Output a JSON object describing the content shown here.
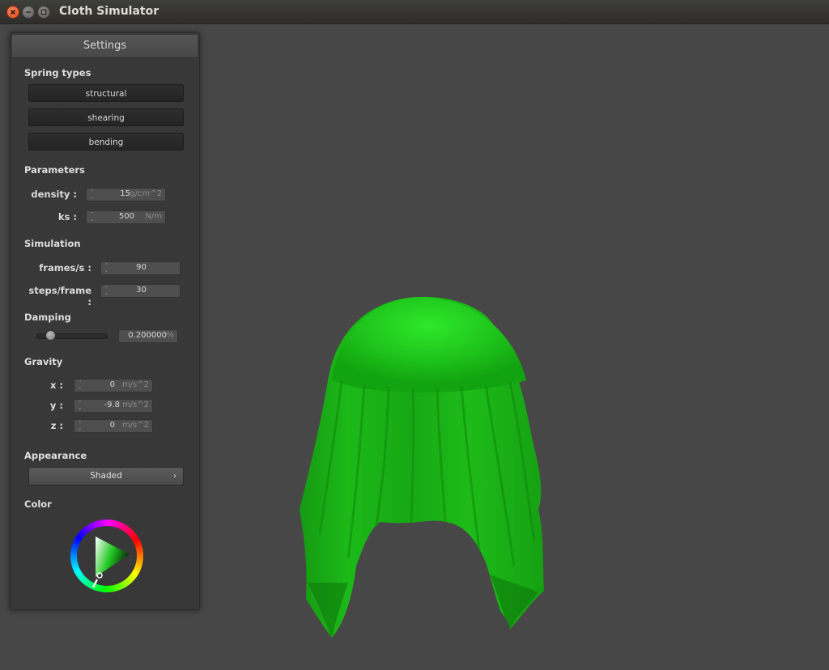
{
  "window": {
    "title": "Cloth Simulator"
  },
  "panel": {
    "title": "Settings",
    "spring_types": {
      "heading": "Spring types",
      "buttons": [
        "structural",
        "shearing",
        "bending"
      ]
    },
    "parameters": {
      "heading": "Parameters",
      "density": {
        "label": "density :",
        "value": "15",
        "unit": "g/cm^2"
      },
      "ks": {
        "label": "ks :",
        "value": "500",
        "unit": "N/m"
      }
    },
    "simulation": {
      "heading": "Simulation",
      "fps": {
        "label": "frames/s :",
        "value": "90"
      },
      "steps": {
        "label": "steps/frame :",
        "value": "30"
      }
    },
    "damping": {
      "heading": "Damping",
      "value": "0.200000",
      "unit": "%",
      "slider_fraction": 0.2
    },
    "gravity": {
      "heading": "Gravity",
      "x": {
        "label": "x :",
        "value": "0",
        "unit": "m/s^2"
      },
      "y": {
        "label": "y :",
        "value": "-9.8",
        "unit": "m/s^2"
      },
      "z": {
        "label": "z :",
        "value": "0",
        "unit": "m/s^2"
      }
    },
    "appearance": {
      "heading": "Appearance",
      "selected": "Shaded",
      "chevron_icon": "chevron-right-icon"
    },
    "color": {
      "heading": "Color",
      "selected_color": "#1fc81f"
    }
  },
  "scene": {
    "cloth_color": "#1fc81f",
    "background": "#474747"
  }
}
